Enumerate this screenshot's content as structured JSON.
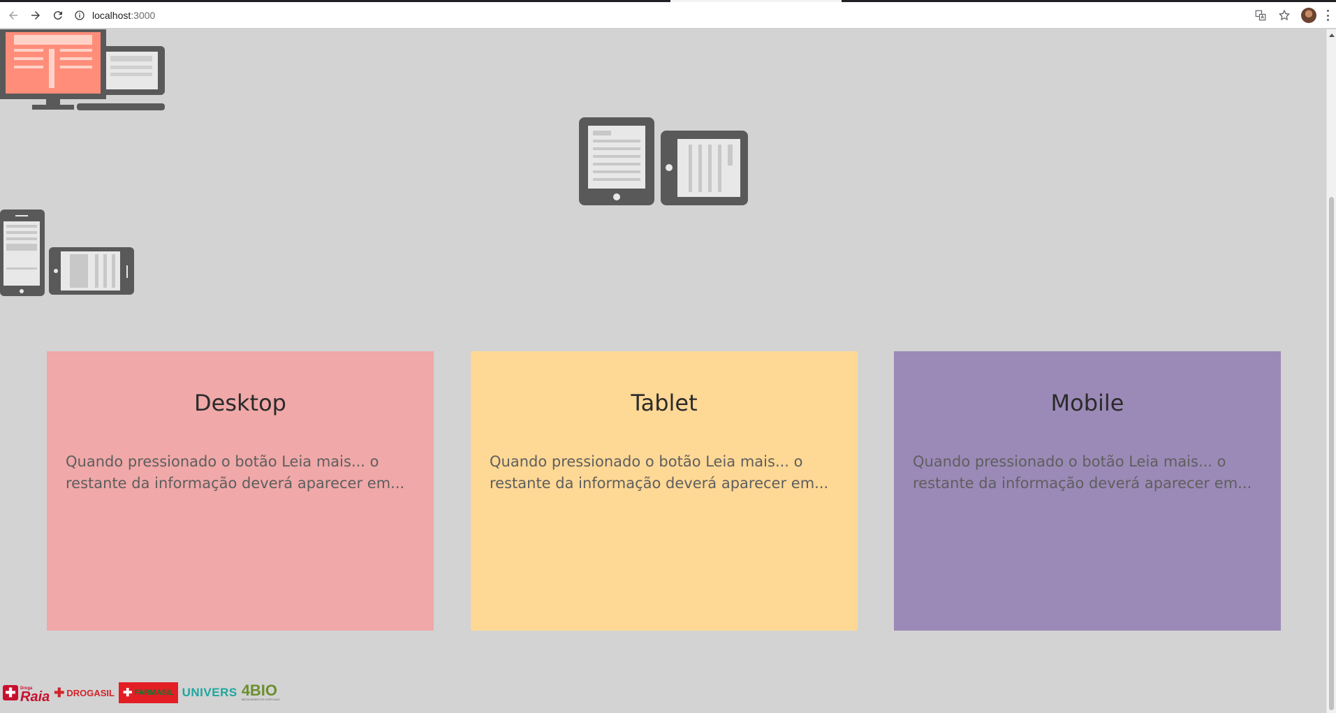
{
  "browser": {
    "url_host": "localhost",
    "url_port": ":3000"
  },
  "cards": [
    {
      "title": "Desktop",
      "text": "Quando pressionado o botão Leia mais... o restante da informação deverá aparecer em...",
      "color": "#f0a8a8"
    },
    {
      "title": "Tablet",
      "text": "Quando pressionado o botão Leia mais... o restante da informação deverá aparecer em...",
      "color": "#fed895"
    },
    {
      "title": "Mobile",
      "text": "Quando pressionado o botão Leia mais... o restante da informação deverá aparecer em...",
      "color": "#9b8ab7"
    }
  ],
  "icons": {
    "desktop_illustration": "desktop-and-laptop-icon",
    "tablet_illustration": "tablets-icon",
    "mobile_illustration": "phones-icon"
  },
  "footer_logos": {
    "raia": "Raia",
    "raia_small": "Droga",
    "drogasil": "DROGASIL",
    "farmasil": "FARMASIL",
    "univers": "UNIVERS",
    "fourbio": "4BIO",
    "fourbio_sub": "MEDICAMENTOS ESPECIAIS"
  }
}
